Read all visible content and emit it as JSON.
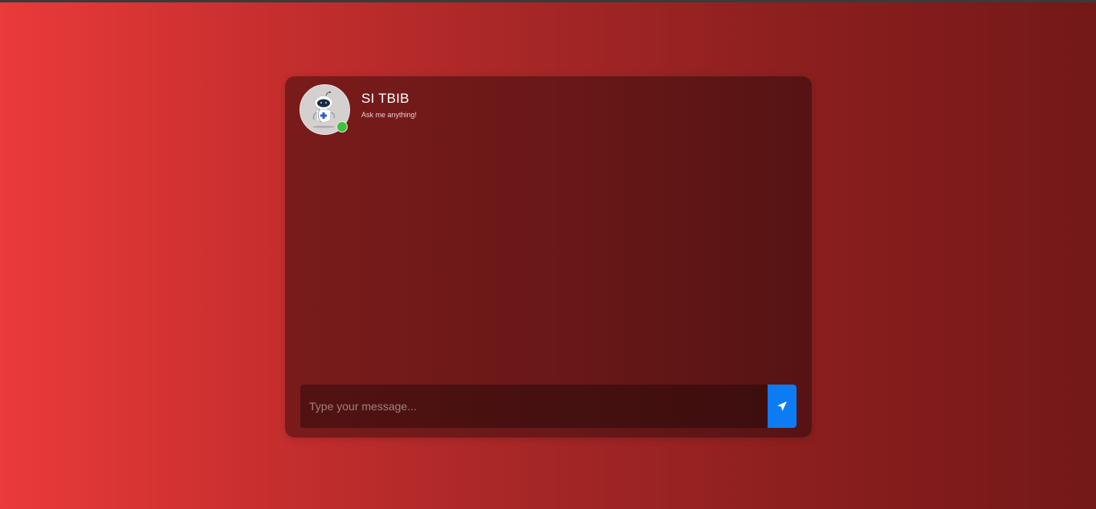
{
  "colors": {
    "accent": "#0d7cf2",
    "online": "#3cc23c",
    "background_start": "#ea3a3a",
    "background_end": "#741818",
    "card": "#6a1818"
  },
  "chat": {
    "bot_name": "SI TBIB",
    "status_text": "Ask me anything!",
    "avatar_icon": "robot-doctor-icon",
    "online_indicator": "online-status-dot",
    "messages": []
  },
  "input": {
    "placeholder": "Type your message...",
    "value": ""
  },
  "send": {
    "icon": "paper-plane-icon"
  }
}
